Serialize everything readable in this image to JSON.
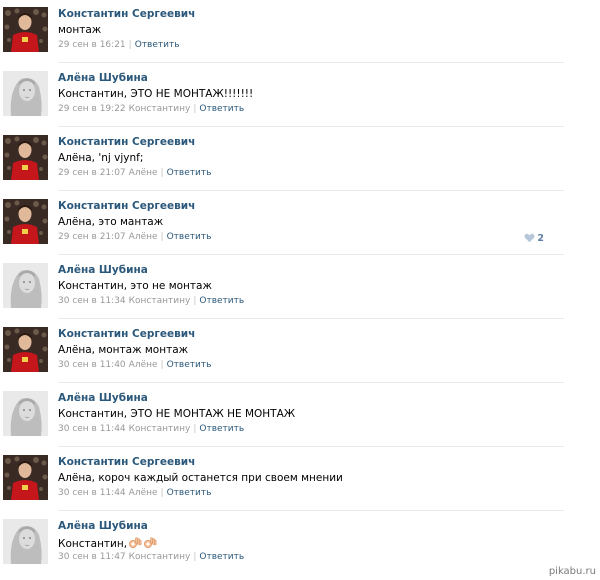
{
  "comments": [
    {
      "author": "Константин Сергеевич",
      "avatar": "man-red-avatar",
      "text": "монтаж",
      "time": "29 сен в 16:21",
      "addressee": "",
      "reply": "Ответить",
      "likes": ""
    },
    {
      "author": "Алёна Шубина",
      "avatar": "woman-gray-avatar",
      "text": "Константин, ЭТО НЕ МОНТАЖ!!!!!!!",
      "time": "29 сен в 19:22",
      "addressee": "Константину",
      "reply": "Ответить",
      "likes": ""
    },
    {
      "author": "Константин Сергеевич",
      "avatar": "man-red-avatar",
      "text": "Алёна, 'nj vjynf;",
      "time": "29 сен в 21:07",
      "addressee": "Алёне",
      "reply": "Ответить",
      "likes": ""
    },
    {
      "author": "Константин Сергеевич",
      "avatar": "man-red-avatar",
      "text": "Алёна, это мантаж",
      "time": "29 сен в 21:07",
      "addressee": "Алёне",
      "reply": "Ответить",
      "likes": "2"
    },
    {
      "author": "Алёна Шубина",
      "avatar": "woman-gray-avatar",
      "text": "Константин, это не монтаж",
      "time": "30 сен в 11:34",
      "addressee": "Константину",
      "reply": "Ответить",
      "likes": ""
    },
    {
      "author": "Константин Сергеевич",
      "avatar": "man-red-avatar",
      "text": "Алёна, монтаж монтаж",
      "time": "30 сен в 11:40",
      "addressee": "Алёне",
      "reply": "Ответить",
      "likes": ""
    },
    {
      "author": "Алёна Шубина",
      "avatar": "woman-gray-avatar",
      "text": "Константин, ЭТО НЕ МОНТАЖ НЕ МОНТАЖ",
      "time": "30 сен в 11:44",
      "addressee": "Константину",
      "reply": "Ответить",
      "likes": ""
    },
    {
      "author": "Константин Сергеевич",
      "avatar": "man-red-avatar",
      "text": "Алёна, короч каждый останется при своем мнении",
      "time": "30 сен в 11:44",
      "addressee": "Алёне",
      "reply": "Ответить",
      "likes": ""
    },
    {
      "author": "Алёна Шубина",
      "avatar": "woman-gray-avatar",
      "text": "Константин,",
      "emoji": [
        "ok-hand-icon",
        "ok-hand-icon"
      ],
      "time": "30 сен в 11:47",
      "addressee": "Константину",
      "reply": "Ответить",
      "likes": ""
    }
  ],
  "like_icon": "heart-icon",
  "watermark": "pikabu.ru",
  "colors": {
    "link": "#2b587a",
    "meta": "#999999",
    "divider": "#e7eaed",
    "like": "#5f7fa6",
    "avatar_man": "#b5161a",
    "avatar_woman": "#c9c9c9"
  }
}
